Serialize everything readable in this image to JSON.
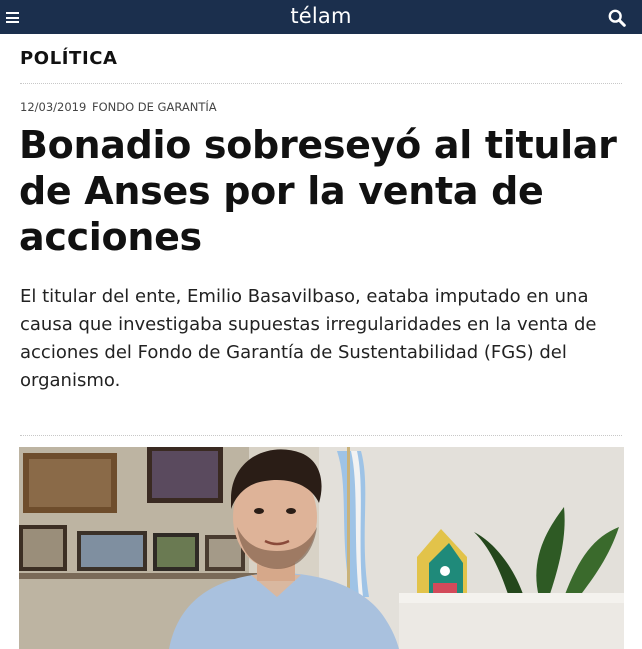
{
  "header": {
    "logo_text": "télam",
    "menu_icon": "hamburger-menu-icon",
    "search_icon": "search-icon",
    "background_color": "#1b2f4d"
  },
  "article": {
    "section": "POLÍTICA",
    "date": "12/03/2019",
    "tag": "FONDO DE GARANTÍA",
    "headline": "Bonadio sobreseyó al titular de Anses por la venta de acciones",
    "lead": "El titular del ente, Emilio Basavilbaso, eataba imputado en una causa que investigaba supuestas irregularidades en la venta de acciones del Fondo de Garantía de Sustentabilidad (FGS) del organismo."
  }
}
